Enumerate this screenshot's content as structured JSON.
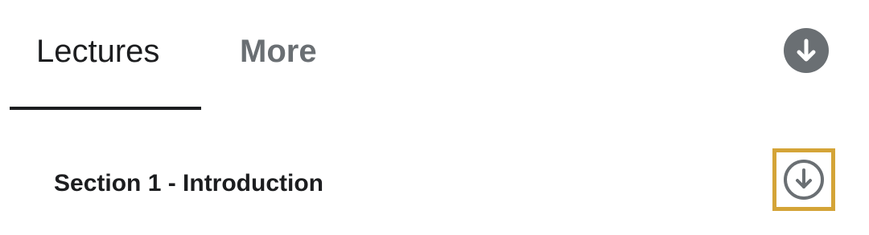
{
  "tabs": [
    {
      "label": "Lectures",
      "selected": true
    },
    {
      "label": "More",
      "selected": false
    }
  ],
  "download_all": {
    "icon": "download-circle-filled-icon",
    "color": "#6a6f73"
  },
  "sections": [
    {
      "title": "Section 1 - Introduction",
      "icon": "download-circle-outline-icon",
      "highlight_color": "#d4a437"
    }
  ],
  "colors": {
    "text_primary": "#1c1d1f",
    "text_secondary": "#6a6f73",
    "icon": "#6a6f73",
    "highlight": "#d4a437"
  }
}
